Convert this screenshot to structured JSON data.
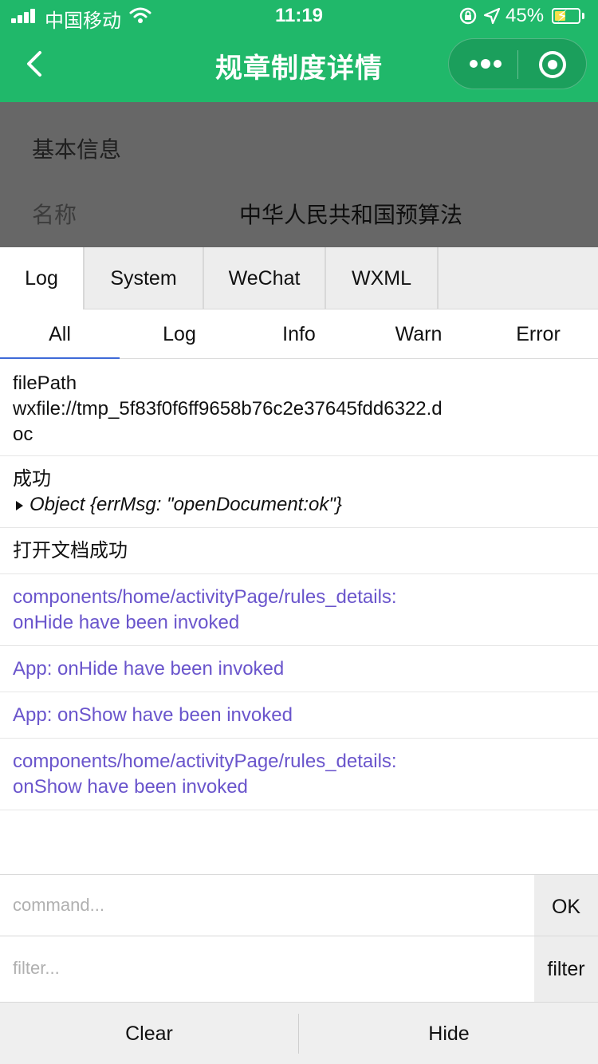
{
  "status_bar": {
    "carrier": "中国移动",
    "time": "11:19",
    "battery": "45%",
    "battery_level": 0.45,
    "battery_fill_color": "#f7e04a"
  },
  "nav": {
    "title": "规章制度详情",
    "back_icon": "chevron-left-icon",
    "more_icon": "more-dots-icon",
    "close_icon": "target-close-icon",
    "bar_color": "#20b86a"
  },
  "page": {
    "section_title": "基本信息",
    "fields": [
      {
        "label": "名称",
        "value": "中华人民共和国预算法"
      }
    ]
  },
  "console": {
    "tabs": [
      {
        "label": "Log",
        "active": true
      },
      {
        "label": "System",
        "active": false
      },
      {
        "label": "WeChat",
        "active": false
      },
      {
        "label": "WXML",
        "active": false
      }
    ],
    "filters": [
      {
        "label": "All",
        "active": true
      },
      {
        "label": "Log",
        "active": false
      },
      {
        "label": "Info",
        "active": false
      },
      {
        "label": "Warn",
        "active": false
      },
      {
        "label": "Error",
        "active": false
      }
    ],
    "logs": [
      {
        "lines": [
          "filePath",
          "wxfile://tmp_5f83f0f6ff9658b76c2e37645fdd6322.d",
          "oc"
        ],
        "color": "#111111"
      },
      {
        "lines": [
          "成功"
        ],
        "object": "Object {errMsg: \"openDocument:ok\"}",
        "color": "#111111"
      },
      {
        "lines": [
          "打开文档成功"
        ],
        "color": "#111111"
      },
      {
        "lines": [
          "components/home/activityPage/rules_details:",
          "onHide have been invoked"
        ],
        "color": "#6a55cc"
      },
      {
        "lines": [
          "App: onHide have been invoked"
        ],
        "color": "#6a55cc"
      },
      {
        "lines": [
          "App: onShow have been invoked"
        ],
        "color": "#6a55cc"
      },
      {
        "lines": [
          "components/home/activityPage/rules_details:",
          "onShow have been invoked"
        ],
        "color": "#6a55cc"
      }
    ],
    "command": {
      "placeholder": "command...",
      "button": "OK"
    },
    "filter": {
      "placeholder": "filter...",
      "button": "filter"
    },
    "footer": {
      "clear": "Clear",
      "hide": "Hide"
    }
  }
}
